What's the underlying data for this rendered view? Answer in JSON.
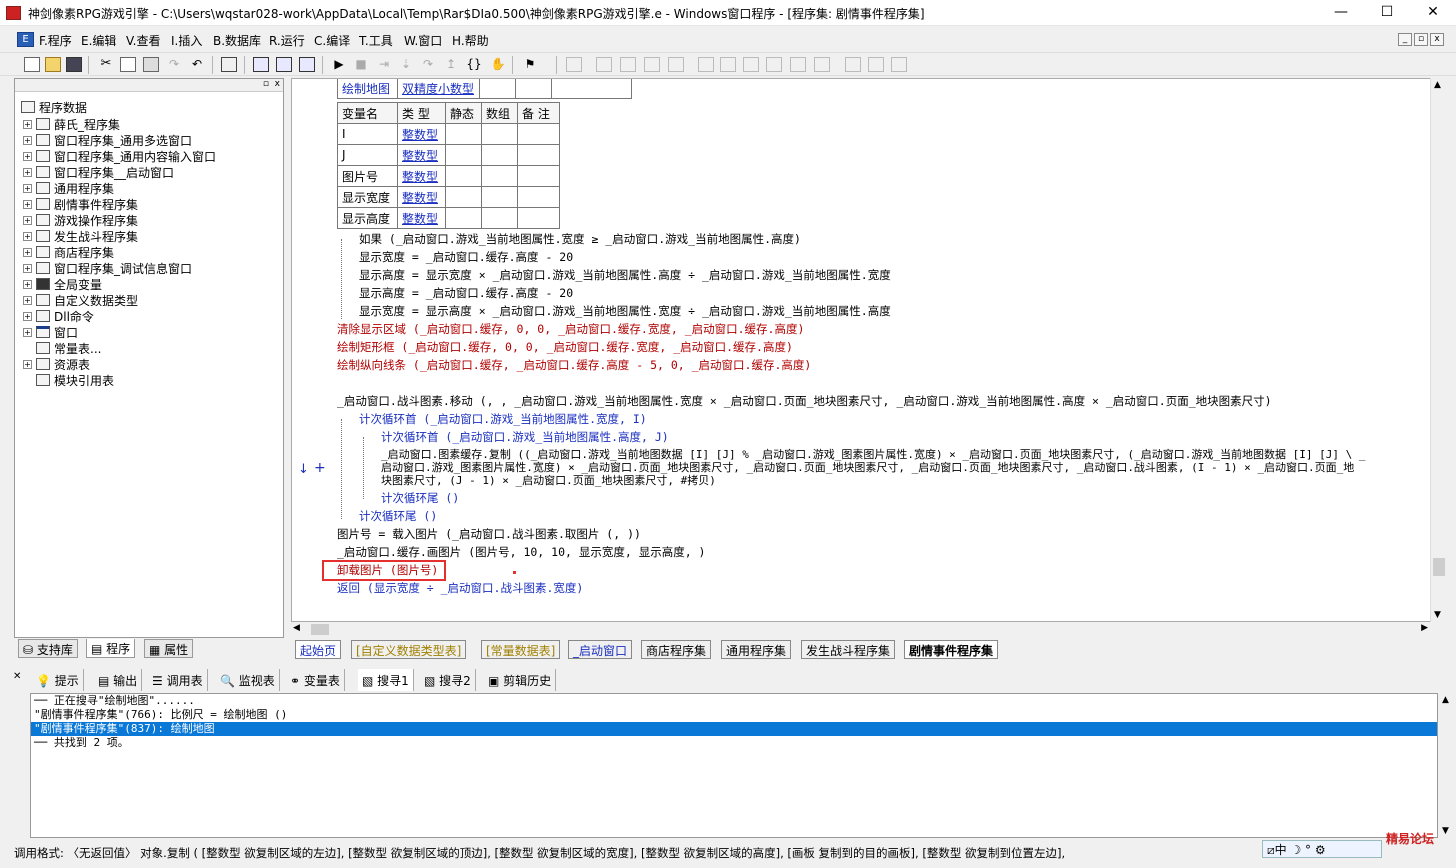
{
  "window": {
    "title": "神剑像素RPG游戏引擎 - C:\\Users\\wqstar028-work\\AppData\\Local\\Temp\\Rar$DIa0.500\\神剑像素RPG游戏引擎.e - Windows窗口程序 - [程序集: 剧情事件程序集]",
    "minimize": "—",
    "maximize": "☐",
    "close": "✕"
  },
  "menu": [
    "F.程序",
    "E.编辑",
    "V.查看",
    "I.插入",
    "B.数据库",
    "R.运行",
    "C.编译",
    "T.工具",
    "W.窗口",
    "H.帮助"
  ],
  "tree": {
    "root": "程序数据",
    "items": [
      "薛氏_程序集",
      "窗口程序集_通用多选窗口",
      "窗口程序集_通用内容输入窗口",
      "窗口程序集__启动窗口",
      "通用程序集",
      "剧情事件程序集",
      "游戏操作程序集",
      "发生战斗程序集",
      "商店程序集",
      "窗口程序集_调试信息窗口",
      "全局变量",
      "自定义数据类型",
      "Dll命令",
      "窗口",
      "常量表...",
      "资源表",
      "模块引用表"
    ]
  },
  "left_tabs": [
    "支持库",
    "程序",
    "属性"
  ],
  "editor": {
    "header": [
      "绘制地图",
      "双精度小数型"
    ],
    "var_headers": [
      "变量名",
      "类 型",
      "静态",
      "数组",
      "备 注"
    ],
    "vars": [
      [
        "I",
        "整数型"
      ],
      [
        "J",
        "整数型"
      ],
      [
        "图片号",
        "整数型"
      ],
      [
        "显示宽度",
        "整数型"
      ],
      [
        "显示高度",
        "整数型"
      ]
    ],
    "code": [
      "如果 (_启动窗口.游戏_当前地图属性.宽度 ≥ _启动窗口.游戏_当前地图属性.高度)",
      "显示宽度 = _启动窗口.缓存.高度 - 20",
      "显示高度 = 显示宽度 × _启动窗口.游戏_当前地图属性.高度 ÷ _启动窗口.游戏_当前地图属性.宽度",
      "显示高度 = _启动窗口.缓存.高度 - 20",
      "显示宽度 = 显示高度 × _启动窗口.游戏_当前地图属性.宽度 ÷ _启动窗口.游戏_当前地图属性.高度",
      "清除显示区域 (_启动窗口.缓存, 0, 0, _启动窗口.缓存.宽度, _启动窗口.缓存.高度)",
      "绘制矩形框 (_启动窗口.缓存, 0, 0, _启动窗口.缓存.宽度, _启动窗口.缓存.高度)",
      "绘制纵向线条 (_启动窗口.缓存, _启动窗口.缓存.高度 - 5, 0, _启动窗口.缓存.高度)",
      "_启动窗口.战斗图素.移动 (, , _启动窗口.游戏_当前地图属性.宽度 × _启动窗口.页面_地块图素尺寸, _启动窗口.游戏_当前地图属性.高度 × _启动窗口.页面_地块图素尺寸)",
      "计次循环首 (_启动窗口.游戏_当前地图属性.宽度, I)",
      "计次循环首 (_启动窗口.游戏_当前地图属性.高度, J)",
      "_启动窗口.图素缓存.复制 ((_启动窗口.游戏_当前地图数据 [I] [J] % _启动窗口.游戏_图素图片属性.宽度) × _启动窗口.页面_地块图素尺寸, (_启动窗口.游戏_当前地图数据 [I] [J] \\ _",
      "启动窗口.游戏_图素图片属性.宽度) × _启动窗口.页面_地块图素尺寸, _启动窗口.页面_地块图素尺寸, _启动窗口.页面_地块图素尺寸, _启动窗口.战斗图素, (I - 1) × _启动窗口.页面_地",
      "块图素尺寸, (J - 1) × _启动窗口.页面_地块图素尺寸, #拷贝)",
      "计次循环尾 ()",
      "计次循环尾 ()",
      "图片号 = 载入图片 (_启动窗口.战斗图素.取图片 (, ))",
      "_启动窗口.缓存.画图片 (图片号, 10, 10, 显示宽度, 显示高度, )",
      "卸载图片 (图片号)",
      "返回 (显示宽度 ÷ _启动窗口.战斗图素.宽度)"
    ]
  },
  "editor_tabs": [
    "起始页",
    "[自定义数据类型表]",
    "[常量数据表]",
    "_启动窗口",
    "商店程序集",
    "通用程序集",
    "发生战斗程序集",
    "剧情事件程序集"
  ],
  "bottom_tabs": [
    "提示",
    "输出",
    "调用表",
    "监视表",
    "变量表",
    "搜寻1",
    "搜寻2",
    "剪辑历史"
  ],
  "output": [
    "── 正在搜寻\"绘制地图\"......",
    "\"剧情事件程序集\"(766): 比例尺 = 绘制地图 ()",
    "\"剧情事件程序集\"(837): 绘制地图",
    "── 共找到 2 项。"
  ],
  "statusbar": "调用格式: 〈无返回值〉 对象.复制 ( [整数型 欲复制区域的左边], [整数型 欲复制区域的顶边], [整数型 欲复制区域的宽度], [整数型 欲复制区域的高度], [画板 复制到的目的画板], [整数型 欲复制到位置左边],",
  "watermark": "精易论坛",
  "colors": {
    "selection": "#0a78d7",
    "keyword": "#1a2fbf",
    "highlight_box": "#e53030"
  }
}
